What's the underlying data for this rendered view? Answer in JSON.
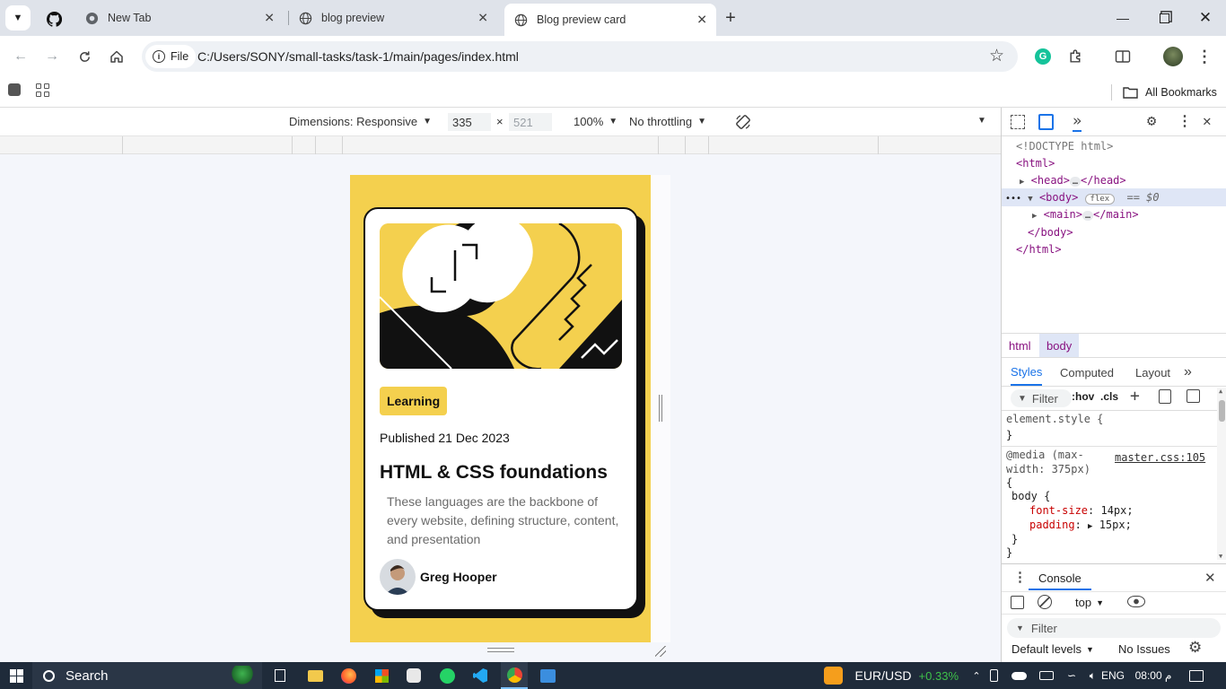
{
  "browser": {
    "tabs": [
      {
        "title": "New Tab",
        "active": false
      },
      {
        "title": "blog preview",
        "active": false
      },
      {
        "title": "Blog preview card",
        "active": true
      }
    ],
    "address": {
      "scheme_chip": "File",
      "url": "C:/Users/SONY/small-tasks/task-1/main/pages/index.html"
    },
    "bookmarks": {
      "all_label": "All Bookmarks"
    }
  },
  "device_toolbar": {
    "dimensions_label": "Dimensions: Responsive",
    "width": "335",
    "height_placeholder": "521",
    "times": "×",
    "zoom": "100%",
    "throttling": "No throttling"
  },
  "card": {
    "tag": "Learning",
    "published": "Published 21 Dec 2023",
    "title": "HTML & CSS foundations",
    "description": "These languages are the backbone of every website, defining structure, content, and presentation",
    "author": "Greg Hooper"
  },
  "devtools": {
    "dom": {
      "doctype": "<!DOCTYPE html>",
      "html_open": "<html>",
      "head_open": "<head>",
      "head_close": "</head>",
      "body_open": "<body>",
      "flex_badge": "flex",
      "selected_marker": "== $0",
      "main_open": "<main>",
      "main_close": "</main>",
      "body_close": "</body>",
      "html_close": "</html>",
      "ellipsis": "…"
    },
    "breadcrumbs": [
      "html",
      "body"
    ],
    "styles_tabs": [
      "Styles",
      "Computed",
      "Layout"
    ],
    "filter_placeholder": "Filter",
    "hov": ":hov",
    "cls": ".cls",
    "rules": {
      "element_style": "element.style {",
      "close_brace": "}",
      "media_line1": "@media (max-",
      "media_line2": "width: 375px)",
      "media_open": "{",
      "source": "master.css:105",
      "selector": "body {",
      "prop1_name": "font-size",
      "prop1_value": "14px;",
      "prop2_name": "padding",
      "prop2_value": "15px;",
      "inner_close": "}",
      "outer_close": "}"
    },
    "console": {
      "title": "Console",
      "context": "top",
      "filter_placeholder": "Filter",
      "levels": "Default levels",
      "issues": "No Issues"
    }
  },
  "taskbar": {
    "search": "Search",
    "ticker": "EUR/USD",
    "ticker_change": "+0.33%",
    "lang": "ENG",
    "time": "08:00 م"
  },
  "colors": {
    "card_yellow": "#f4d04e",
    "ticker_green": "#3ec14a"
  }
}
